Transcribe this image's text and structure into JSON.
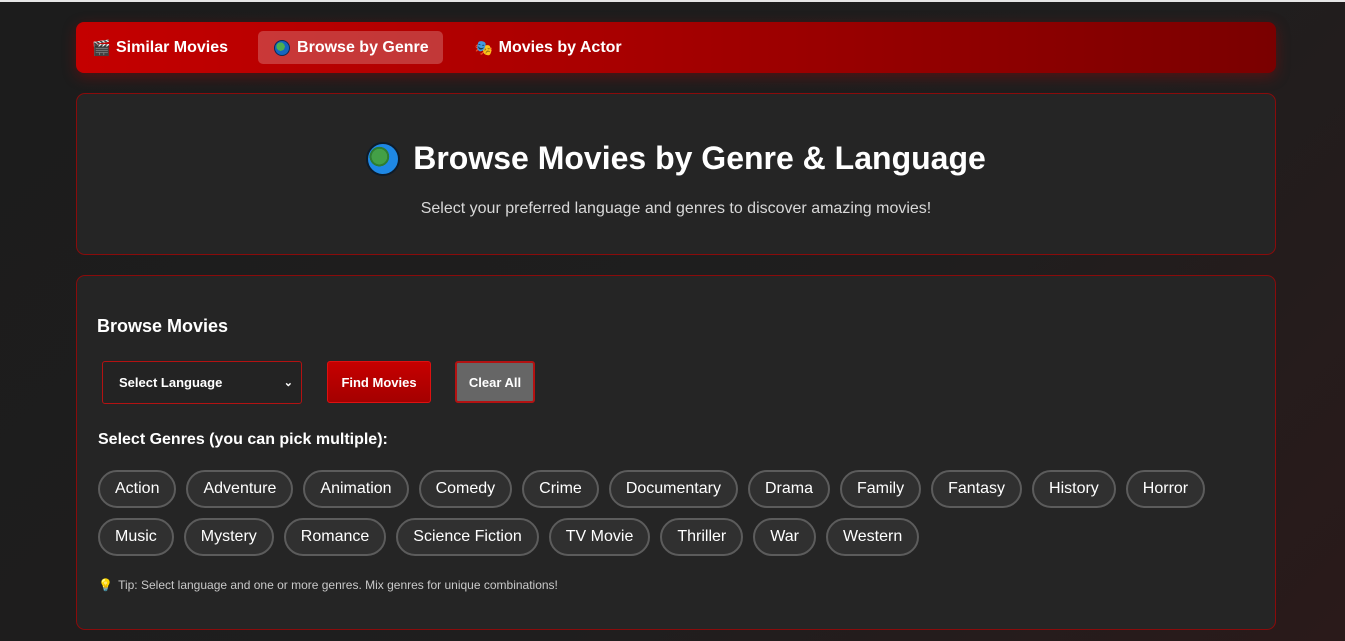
{
  "nav": {
    "tabs": [
      {
        "label": "Similar Movies",
        "icon": "clapperboard-icon",
        "glyph": "🎬",
        "active": false
      },
      {
        "label": "Browse by Genre",
        "icon": "globe-icon",
        "glyph": "",
        "active": true
      },
      {
        "label": "Movies by Actor",
        "icon": "theater-masks-icon",
        "glyph": "🎭",
        "active": false
      }
    ]
  },
  "hero": {
    "title": "Browse Movies by Genre & Language",
    "subtitle": "Select your preferred language and genres to discover amazing movies!"
  },
  "browse": {
    "title": "Browse Movies",
    "language_select": "Select Language",
    "find_button": "Find Movies",
    "clear_button": "Clear All",
    "genres_label": "Select Genres (you can pick multiple):",
    "genres": [
      "Action",
      "Adventure",
      "Animation",
      "Comedy",
      "Crime",
      "Documentary",
      "Drama",
      "Family",
      "Fantasy",
      "History",
      "Horror",
      "Music",
      "Mystery",
      "Romance",
      "Science Fiction",
      "TV Movie",
      "Thriller",
      "War",
      "Western"
    ],
    "tip": "Tip: Select language and one or more genres. Mix genres for unique combinations!"
  },
  "colors": {
    "accent": "#c40000",
    "background": "#1c1c1c",
    "card": "#252525",
    "border": "#8a0b0b"
  }
}
